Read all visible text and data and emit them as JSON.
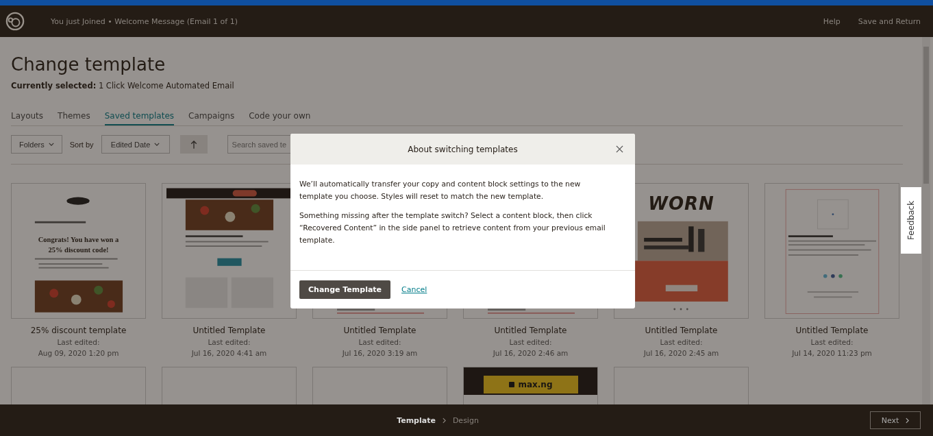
{
  "header": {
    "title": "You just Joined • Welcome Message (Email 1 of 1)",
    "links": [
      "Help",
      "Save and Return"
    ]
  },
  "page": {
    "title": "Change template",
    "selected_label": "Currently selected:",
    "selected_value": "1 Click Welcome Automated Email"
  },
  "tabs": [
    {
      "label": "Layouts",
      "selected": false
    },
    {
      "label": "Themes",
      "selected": false
    },
    {
      "label": "Saved templates",
      "selected": true
    },
    {
      "label": "Campaigns",
      "selected": false
    },
    {
      "label": "Code your own",
      "selected": false
    }
  ],
  "toolbar": {
    "folders": "Folders",
    "sort_label": "Sort by",
    "sort_value": "Edited Date",
    "search": {
      "placeholder": "Search saved te"
    }
  },
  "templates": [
    {
      "kind": "pizza-promo",
      "headline": "Congrats! You have won a 25% discount code!",
      "name": "25% discount template",
      "label": "Last edited:",
      "date": "Aug 09, 2020 1:20 pm"
    },
    {
      "kind": "pizza-feature",
      "name": "Untitled Template",
      "label": "Last edited:",
      "date": "Jul 16, 2020 4:41 am"
    },
    {
      "kind": "generic",
      "name": "Untitled Template",
      "label": "Last edited:",
      "date": "Jul 16, 2020 3:19 am"
    },
    {
      "kind": "generic",
      "name": "Untitled Template",
      "label": "Last edited:",
      "date": "Jul 16, 2020 2:46 am"
    },
    {
      "kind": "worn",
      "headline": "WORN",
      "name": "Untitled Template",
      "label": "Last edited:",
      "date": "Jul 16, 2020 2:45 am"
    },
    {
      "kind": "design",
      "name": "Untitled Template",
      "label": "Last edited:",
      "date": "Jul 14, 2020 11:23 pm"
    },
    {
      "kind": "blank"
    },
    {
      "kind": "blank"
    },
    {
      "kind": "blank"
    },
    {
      "kind": "max",
      "headline": "max.ng"
    },
    {
      "kind": "blank"
    }
  ],
  "modal": {
    "title": "About switching templates",
    "paragraphs": [
      "We’ll automatically transfer your copy and content block settings to the new template you choose. Styles will reset to match the new template.",
      "Something missing after the template switch? Select a content block, then click “Recovered Content” in the side panel to retrieve content from your previous email template."
    ],
    "primary": "Change Template",
    "cancel": "Cancel"
  },
  "feedback": "Feedback",
  "footer": {
    "steps": [
      {
        "label": "Template",
        "selected": true
      },
      {
        "label": "Design",
        "selected": false
      }
    ],
    "next": "Next"
  }
}
